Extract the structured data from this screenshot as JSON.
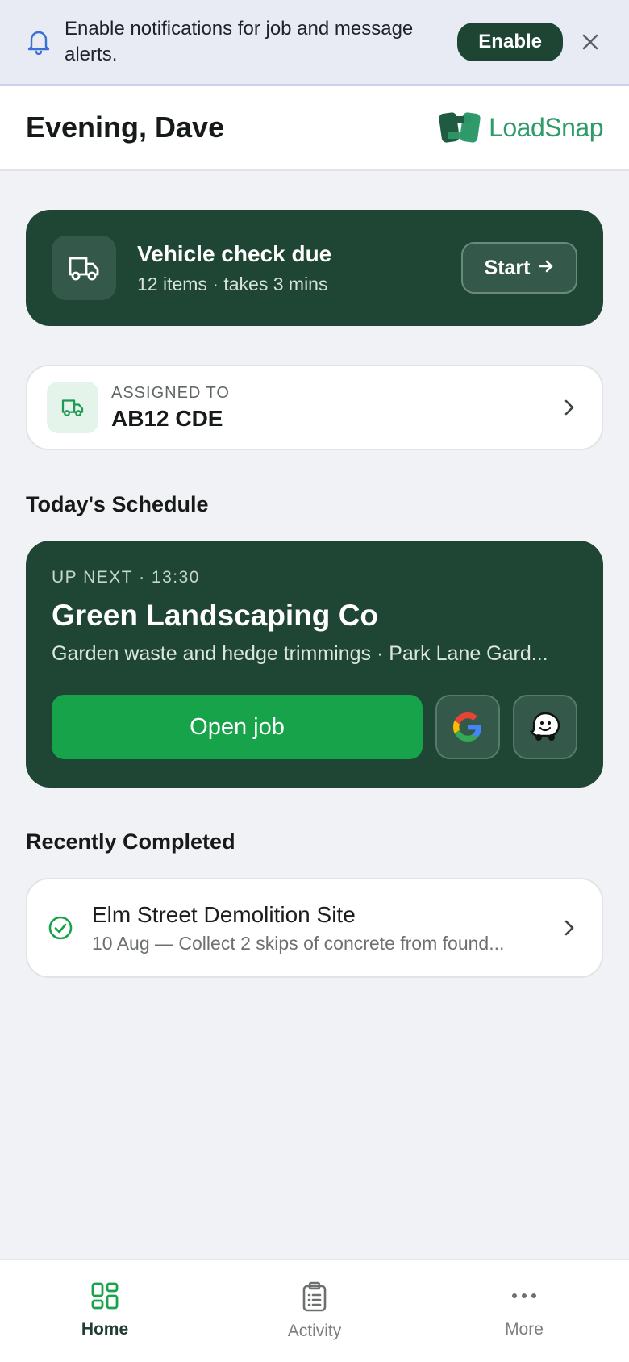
{
  "banner": {
    "message": "Enable notifications for job and message alerts.",
    "enable_label": "Enable",
    "icon": "bell-icon",
    "close_icon": "close-icon"
  },
  "header": {
    "greeting": "Evening, Dave",
    "logo_text": "LoadSnap"
  },
  "vehicle_check": {
    "title": "Vehicle check due",
    "subtitle": "12 items · takes 3 mins",
    "start_label": "Start",
    "icon": "truck-icon"
  },
  "assigned": {
    "label": "ASSIGNED TO",
    "value": "AB12 CDE"
  },
  "schedule": {
    "section_title": "Today's Schedule",
    "up_next": "UP NEXT · 13:30",
    "company": "Green Landscaping Co",
    "description": "Garden waste and hedge trimmings · Park Lane Gard...",
    "open_label": "Open job",
    "nav_options": [
      "google-maps-icon",
      "waze-icon"
    ]
  },
  "completed": {
    "section_title": "Recently Completed",
    "items": [
      {
        "name": "Elm Street Demolition Site",
        "meta": "10 Aug — Collect 2 skips of concrete from found..."
      }
    ]
  },
  "tabs": [
    {
      "label": "Home",
      "icon": "grid-icon",
      "active": true
    },
    {
      "label": "Activity",
      "icon": "clipboard-icon",
      "active": false
    },
    {
      "label": "More",
      "icon": "more-icon",
      "active": false
    }
  ],
  "colors": {
    "primary_dark": "#1f4535",
    "accent_green": "#16a34a",
    "brand_green": "#2f9a6a",
    "background": "#f1f2f5"
  }
}
